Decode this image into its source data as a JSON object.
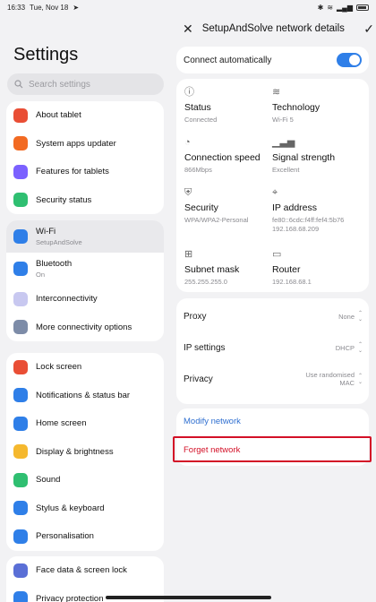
{
  "status_bar": {
    "time": "16:33",
    "date": "Tue, Nov 18",
    "icons": [
      "send-icon",
      "bluetooth-icon",
      "wifi-icon",
      "signal-icon",
      "battery-icon"
    ]
  },
  "left": {
    "title": "Settings",
    "search_placeholder": "Search settings",
    "groups": [
      {
        "items": [
          {
            "label": "About tablet",
            "icon": "tablet-icon",
            "color": "#e94e35"
          },
          {
            "label": "System apps updater",
            "icon": "update-icon",
            "color": "#f26a22"
          },
          {
            "label": "Features for tablets",
            "icon": "grid-icon",
            "color": "#7b61ff"
          },
          {
            "label": "Security status",
            "icon": "shield-icon",
            "color": "#2fbf71"
          }
        ]
      },
      {
        "items": [
          {
            "label": "Wi-Fi",
            "sub": "SetupAndSolve",
            "icon": "wifi-icon",
            "color": "#2f7fe8",
            "selected": true
          },
          {
            "label": "Bluetooth",
            "sub": "On",
            "icon": "bluetooth-icon",
            "color": "#2f7fe8"
          },
          {
            "label": "Interconnectivity",
            "icon": "interconnect-icon",
            "color": "#c8c8f0"
          },
          {
            "label": "More connectivity options",
            "icon": "link-icon",
            "color": "#7d8ca8"
          }
        ]
      },
      {
        "items": [
          {
            "label": "Lock screen",
            "icon": "lock-icon",
            "color": "#e94e35"
          },
          {
            "label": "Notifications & status bar",
            "icon": "notification-icon",
            "color": "#2f7fe8"
          },
          {
            "label": "Home screen",
            "icon": "home-icon",
            "color": "#2f7fe8"
          },
          {
            "label": "Display & brightness",
            "icon": "sun-icon",
            "color": "#f5b82e"
          },
          {
            "label": "Sound",
            "icon": "sound-icon",
            "color": "#2fbf71"
          },
          {
            "label": "Stylus & keyboard",
            "icon": "keyboard-icon",
            "color": "#2f7fe8"
          },
          {
            "label": "Personalisation",
            "icon": "brush-icon",
            "color": "#2f7fe8"
          }
        ]
      },
      {
        "items": [
          {
            "label": "Face data & screen lock",
            "icon": "face-icon",
            "color": "#5a6fd6"
          },
          {
            "label": "Privacy protection",
            "icon": "privacy-icon",
            "color": "#2f7fe8"
          }
        ]
      }
    ]
  },
  "detail": {
    "title": "SetupAndSolve network details",
    "connect_label": "Connect automatically",
    "connect_on": true,
    "info": [
      {
        "label": "Status",
        "value": "Connected",
        "icon": "info-icon"
      },
      {
        "label": "Technology",
        "value": "Wi-Fi 5",
        "icon": "wifi-icon"
      },
      {
        "label": "Connection speed",
        "value": "866Mbps",
        "icon": "speed-icon"
      },
      {
        "label": "Signal strength",
        "value": "Excellent",
        "icon": "signal-icon"
      },
      {
        "label": "Security",
        "value": "WPA/WPA2-Personal",
        "icon": "security-icon"
      },
      {
        "label": "IP address",
        "value": "fe80::6cdc:f4ff:fef4:5b76\n192.168.68.209",
        "icon": "location-icon"
      },
      {
        "label": "Subnet mask",
        "value": "255.255.255.0",
        "icon": "subnet-icon"
      },
      {
        "label": "Router",
        "value": "192.168.68.1",
        "icon": "router-icon"
      }
    ],
    "options": [
      {
        "label": "Proxy",
        "value": "None"
      },
      {
        "label": "IP settings",
        "value": "DHCP"
      },
      {
        "label": "Privacy",
        "value": "Use randomised\nMAC"
      }
    ],
    "modify_label": "Modify network",
    "forget_label": "Forget network",
    "accent": "#2f7fe8",
    "danger": "#d31027"
  }
}
